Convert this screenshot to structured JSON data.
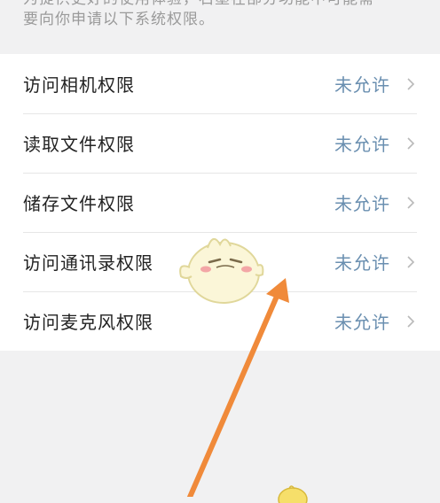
{
  "intro": {
    "line1": "为提供更好的使用体验，石墨在部分功能中可能需",
    "line2": "要向你申请以下系统权限。"
  },
  "permissions": [
    {
      "label": "访问相机权限",
      "status": "未允许"
    },
    {
      "label": "读取文件权限",
      "status": "未允许"
    },
    {
      "label": "储存文件权限",
      "status": "未允许"
    },
    {
      "label": "访问通讯录权限",
      "status": "未允许"
    },
    {
      "label": "访问麦克风权限",
      "status": "未允许"
    }
  ],
  "colors": {
    "background": "#f1f1f2",
    "status": "#6a8fb0",
    "arrow": "#f08a3a"
  },
  "icons": [
    "chevron-right-icon",
    "mascot-sticker",
    "arrow-annotation"
  ]
}
